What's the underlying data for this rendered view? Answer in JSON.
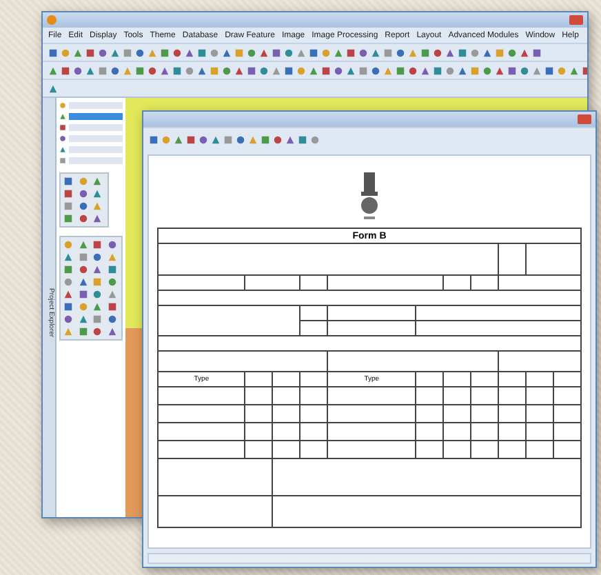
{
  "main_window": {
    "menu": [
      {
        "label": "File"
      },
      {
        "label": "Edit"
      },
      {
        "label": "Display"
      },
      {
        "label": "Tools"
      },
      {
        "label": "Theme"
      },
      {
        "label": "Database"
      },
      {
        "label": "Draw Feature"
      },
      {
        "label": "Image"
      },
      {
        "label": "Image Processing"
      },
      {
        "label": "Report"
      },
      {
        "label": "Layout"
      },
      {
        "label": "Advanced Modules"
      },
      {
        "label": "Window"
      },
      {
        "label": "Help"
      }
    ],
    "side_tab": "Project Explorer",
    "layers": [
      {
        "selected": false
      },
      {
        "selected": true
      },
      {
        "selected": false
      },
      {
        "selected": false
      },
      {
        "selected": false
      },
      {
        "selected": false
      }
    ]
  },
  "report_window": {
    "form_title": "Form B",
    "column_headers": [
      "Type",
      "Type"
    ]
  }
}
